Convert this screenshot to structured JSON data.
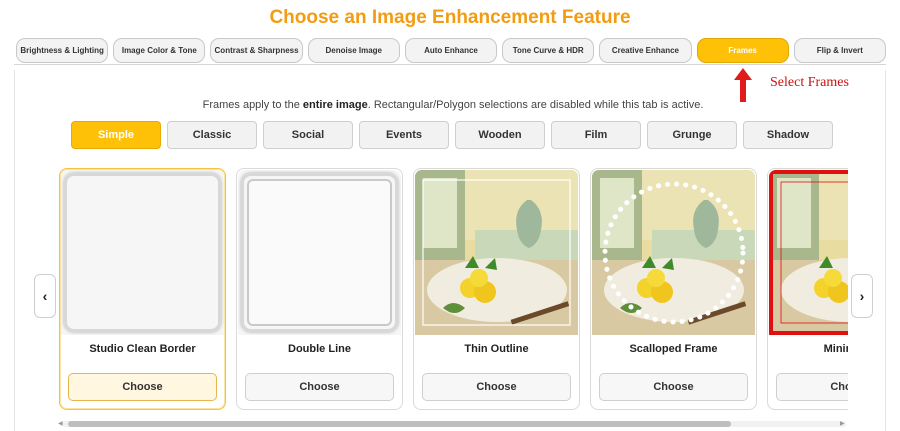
{
  "page_title": "Choose an Image Enhancement Feature",
  "tabs": [
    {
      "label": "Brightness & Lighting",
      "active": false
    },
    {
      "label": "Image Color & Tone",
      "active": false
    },
    {
      "label": "Contrast & Sharpness",
      "active": false
    },
    {
      "label": "Denoise Image",
      "active": false
    },
    {
      "label": "Auto Enhance",
      "active": false
    },
    {
      "label": "Tone Curve & HDR",
      "active": false
    },
    {
      "label": "Creative Enhance",
      "active": false
    },
    {
      "label": "Frames",
      "active": true
    },
    {
      "label": "Flip & Invert",
      "active": false
    }
  ],
  "annotation": {
    "text": "Select Frames",
    "color": "#cc1111"
  },
  "notice": {
    "prefix": "Frames apply to the ",
    "bold": "entire image",
    "suffix": ". Rectangular/Polygon selections are disabled while this tab is active."
  },
  "frame_categories": [
    {
      "label": "Simple",
      "active": true
    },
    {
      "label": "Classic",
      "active": false
    },
    {
      "label": "Social",
      "active": false
    },
    {
      "label": "Events",
      "active": false
    },
    {
      "label": "Wooden",
      "active": false
    },
    {
      "label": "Film",
      "active": false
    },
    {
      "label": "Grunge",
      "active": false
    },
    {
      "label": "Shadow",
      "active": false
    }
  ],
  "frames": [
    {
      "title": "Studio Clean Border",
      "button": "Choose",
      "selected": true
    },
    {
      "title": "Double Line",
      "button": "Choose",
      "selected": false
    },
    {
      "title": "Thin Outline",
      "button": "Choose",
      "selected": false
    },
    {
      "title": "Scalloped Frame",
      "button": "Choose",
      "selected": false
    },
    {
      "title": "Minimalist",
      "button": "Choose",
      "selected": false
    }
  ],
  "carousel": {
    "prev_icon": "‹",
    "next_icon": "›"
  },
  "colors": {
    "accent": "#ffc107",
    "title": "#f39c12",
    "annotation": "#cc1111"
  }
}
